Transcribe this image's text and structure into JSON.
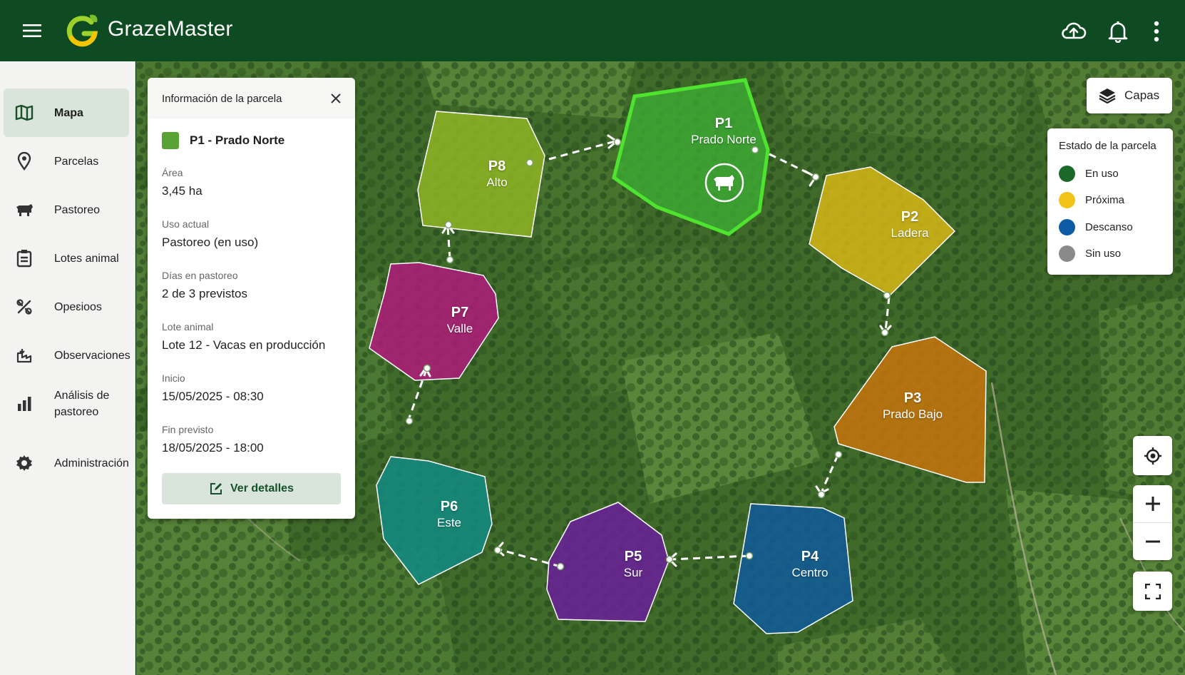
{
  "app": {
    "title": "GrazeMaster"
  },
  "topbar": {
    "icons": [
      "menu-icon",
      "cloud-sync-icon",
      "bell-icon",
      "more-vertical-icon"
    ]
  },
  "sidebar": {
    "items": [
      {
        "label": "Mapa",
        "icon": "map-icon",
        "active": true
      },
      {
        "label": "Parcelas",
        "icon": "location-pin-icon"
      },
      {
        "label": "Pastoreo",
        "icon": "cow-icon"
      },
      {
        "label": "Lotes animal",
        "icon": "clipboard-list-icon"
      },
      {
        "label": "Opeɛioos",
        "icon": "tools-icon"
      },
      {
        "label": "Observaciones",
        "icon": "observation-icon"
      },
      {
        "label": "Análisis de pastoreo",
        "icon": "bar-chart-icon"
      },
      {
        "label": "Administración",
        "icon": "gear-icon"
      }
    ]
  },
  "info_panel": {
    "header": "Información de la parcela",
    "parcel_name": "P1 - Prado Norte",
    "swatch_color": "#5aa233",
    "fields": [
      {
        "label": "Área",
        "value": "3,45 ha"
      },
      {
        "label": "Uso actual",
        "value": "Pastoreo (en uso)"
      },
      {
        "label": "Días en pastoreo",
        "value": "2 de 3 previstos"
      },
      {
        "label": "Lote animal",
        "value": "Lote 12 - Vacas en producción"
      },
      {
        "label": "Inicio",
        "value": "15/05/2025 - 08:30"
      },
      {
        "label": "Fin previsto",
        "value": "18/05/2025 - 18:00"
      }
    ],
    "details_button": "Ver detalles"
  },
  "layers_button": {
    "label": "Capas"
  },
  "legend": {
    "title": "Estado de la parcela",
    "items": [
      {
        "label": "En uso",
        "color": "#1c6a2a"
      },
      {
        "label": "Próxima",
        "color": "#f2c318"
      },
      {
        "label": "Descanso",
        "color": "#0d5aa5"
      },
      {
        "label": "Sin uso",
        "color": "#8a8a8a"
      }
    ]
  },
  "map_controls": [
    "locate-icon",
    "zoom-in-icon",
    "zoom-out-icon",
    "fullscreen-icon"
  ],
  "parcels": [
    {
      "code": "P1",
      "name": "Prado Norte",
      "color": "#3da934",
      "status": "En uso"
    },
    {
      "code": "P2",
      "name": "Ladera",
      "color": "#d7b616"
    },
    {
      "code": "P3",
      "name": "Prado Bajo",
      "color": "#c8740c"
    },
    {
      "code": "P4",
      "name": "Centro",
      "color": "#0f5aa0"
    },
    {
      "code": "P5",
      "name": "Sur",
      "color": "#6a1f9a"
    },
    {
      "code": "P6",
      "name": "Este",
      "color": "#128b82"
    },
    {
      "code": "P7",
      "name": "Valle",
      "color": "#b01a7a"
    },
    {
      "code": "P8",
      "name": "Alto",
      "color": "#8fb523"
    }
  ]
}
